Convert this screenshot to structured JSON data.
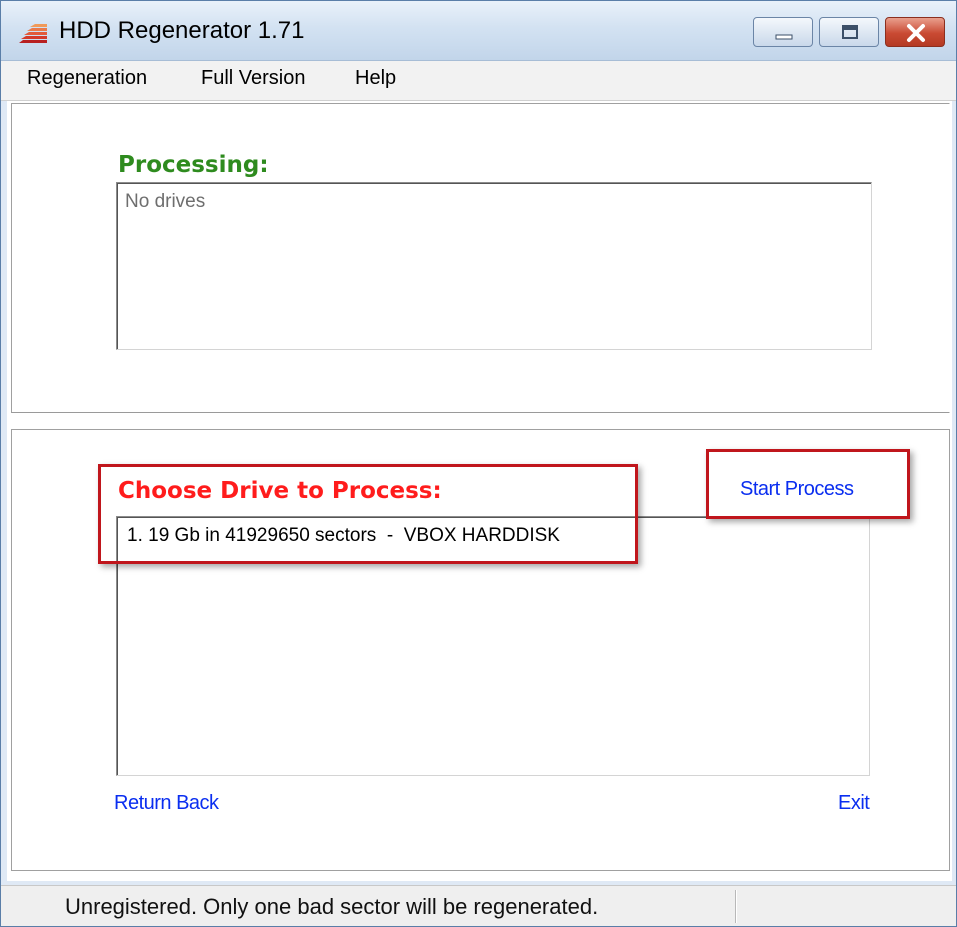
{
  "window": {
    "title": "HDD Regenerator 1.71",
    "icon": "hdd-regenerator-logo-icon"
  },
  "menu": {
    "items": [
      "Regeneration",
      "Full Version",
      "Help"
    ]
  },
  "processing": {
    "heading": "Processing:",
    "heading_color": "#2e8b1e",
    "list_text": "No drives"
  },
  "choose": {
    "heading": "Choose Drive to Process:",
    "heading_color": "#ff1c1c",
    "drives": [
      "1. 19 Gb in 41929650 sectors  -  VBOX HARDDISK"
    ],
    "start_label": "Start Process",
    "back_label": "Return Back",
    "exit_label": "Exit",
    "link_color": "#0a2ef0"
  },
  "status": {
    "text": "Unregistered. Only one bad sector will be regenerated."
  },
  "colors": {
    "annotation": "#c0161c"
  }
}
